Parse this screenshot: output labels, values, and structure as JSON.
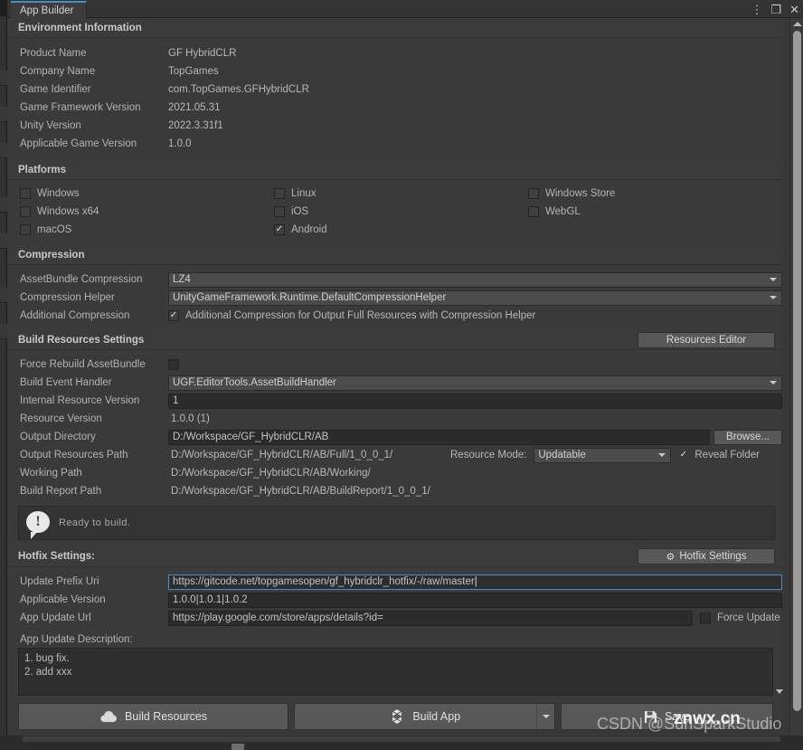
{
  "window": {
    "tab_label": "App Builder",
    "controls": {
      "menu": "⋮",
      "maximize": "❐",
      "close": "✕"
    }
  },
  "environment": {
    "header": "Environment Information",
    "fields": [
      {
        "label": "Product Name",
        "value": "GF HybridCLR"
      },
      {
        "label": "Company Name",
        "value": "TopGames"
      },
      {
        "label": "Game Identifier",
        "value": "com.TopGames.GFHybridCLR"
      },
      {
        "label": "Game Framework Version",
        "value": "2021.05.31"
      },
      {
        "label": "Unity Version",
        "value": "2022.3.31f1"
      },
      {
        "label": "Applicable Game Version",
        "value": "1.0.0"
      }
    ]
  },
  "platforms": {
    "header": "Platforms",
    "columns": [
      [
        {
          "label": "Windows",
          "checked": false
        },
        {
          "label": "Windows x64",
          "checked": false
        },
        {
          "label": "macOS",
          "checked": false
        }
      ],
      [
        {
          "label": "Linux",
          "checked": false
        },
        {
          "label": "iOS",
          "checked": false
        },
        {
          "label": "Android",
          "checked": true
        }
      ],
      [
        {
          "label": "Windows Store",
          "checked": false
        },
        {
          "label": "WebGL",
          "checked": false
        }
      ]
    ]
  },
  "compression": {
    "header": "Compression",
    "assetbundle_label": "AssetBundle Compression",
    "assetbundle_value": "LZ4",
    "helper_label": "Compression Helper",
    "helper_value": "UnityGameFramework.Runtime.DefaultCompressionHelper",
    "additional_label": "Additional Compression",
    "additional_text": "Additional Compression for Output Full Resources with Compression Helper",
    "additional_checked": true
  },
  "build_resources": {
    "header": "Build Resources Settings",
    "editor_button": "Resources Editor",
    "force_rebuild_label": "Force Rebuild AssetBundle",
    "force_rebuild_checked": false,
    "build_event_label": "Build Event Handler",
    "build_event_value": "UGF.EditorTools.AssetBuildHandler",
    "internal_version_label": "Internal Resource Version",
    "internal_version_value": "1",
    "resource_version_label": "Resource Version",
    "resource_version_value": "1.0.0 (1)",
    "output_dir_label": "Output Directory",
    "output_dir_value": "D:/Workspace/GF_HybridCLR/AB",
    "browse_button": "Browse...",
    "output_res_label": "Output Resources Path",
    "output_res_value": "D:/Workspace/GF_HybridCLR/AB/Full/1_0_0_1/",
    "resource_mode_label": "Resource Mode:",
    "resource_mode_value": "Updatable",
    "reveal_label": "Reveal Folder",
    "reveal_checked": true,
    "working_label": "Working Path",
    "working_value": "D:/Workspace/GF_HybridCLR/AB/Working/",
    "report_label": "Build Report Path",
    "report_value": "D:/Workspace/GF_HybridCLR/AB/BuildReport/1_0_0_1/"
  },
  "status": {
    "icon": "info-exclamation-icon",
    "text": "Ready to build."
  },
  "hotfix": {
    "header": "Hotfix Settings:",
    "settings_button": "Hotfix Settings",
    "gear_icon": "gear-icon",
    "prefix_label": "Update Prefix Uri",
    "prefix_value": "https://gitcode.net/topgamesopen/gf_hybridclr_hotfix/-/raw/master",
    "applicable_label": "Applicable Version",
    "applicable_value": "1.0.0|1.0.1|1.0.2",
    "app_url_label": "App Update Url",
    "app_url_value": "https://play.google.com/store/apps/details?id=",
    "force_update_label": "Force Update",
    "force_update_checked": false,
    "description_label": "App Update Description:",
    "description_value": "1. bug fix.\n2. add xxx"
  },
  "actions": [
    {
      "label": "Build Resources",
      "icon": "cloud-icon",
      "dropdown": false
    },
    {
      "label": "Build App",
      "icon": "unity-logo-icon",
      "dropdown": true
    },
    {
      "label": "Save",
      "icon": "floppy-disk-icon",
      "dropdown": false
    }
  ],
  "watermark": {
    "credit": "CSDN @SunSparkStudio",
    "site": "znwx.cn"
  },
  "colors": {
    "accent": "#4a8ec2",
    "panel": "#383838",
    "field": "#2b2b2b",
    "button": "#585858"
  }
}
